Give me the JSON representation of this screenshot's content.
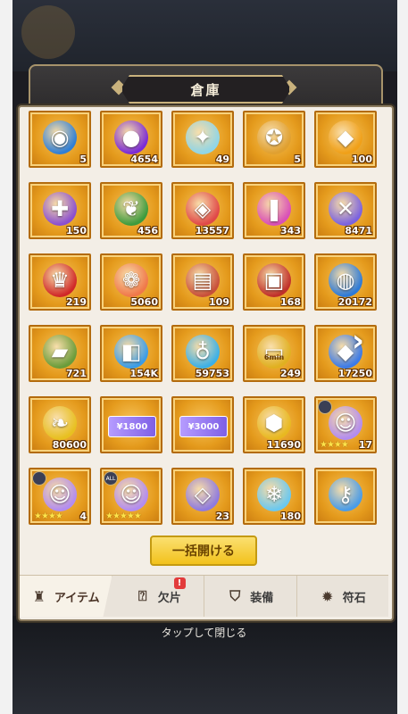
{
  "window": {
    "title": "倉庫"
  },
  "actions": {
    "open_all_label": "一括開ける",
    "close_hint": "タップして閉じる"
  },
  "tabs": [
    {
      "label": "アイテム",
      "icon": "bag-icon",
      "active": true
    },
    {
      "label": "欠片",
      "icon": "question-box-icon",
      "active": false,
      "notification": "!"
    },
    {
      "label": "装備",
      "icon": "shield-icon",
      "active": false
    },
    {
      "label": "符石",
      "icon": "sun-rune-icon",
      "active": false
    }
  ],
  "items": [
    {
      "icon": "portal-orb-icon",
      "qty": "5"
    },
    {
      "icon": "purple-orb-icon",
      "qty": "4654"
    },
    {
      "icon": "star-crystal-icon",
      "qty": "49"
    },
    {
      "icon": "gem-medal-icon",
      "qty": "5"
    },
    {
      "icon": "amber-crystal-icon",
      "qty": "100"
    },
    {
      "icon": "puzzle-piece-icon",
      "qty": "150"
    },
    {
      "icon": "green-crystals-icon",
      "qty": "456"
    },
    {
      "icon": "red-gem-icon",
      "qty": "13557"
    },
    {
      "icon": "pink-scroll-crystal-icon",
      "qty": "343"
    },
    {
      "icon": "crossed-swords-icon",
      "qty": "8471"
    },
    {
      "icon": "red-crystal-crown-icon",
      "qty": "219"
    },
    {
      "icon": "flower-orb-icon",
      "qty": "5060"
    },
    {
      "icon": "map-scroll-icon",
      "qty": "109"
    },
    {
      "icon": "treasure-chest-icon",
      "qty": "168"
    },
    {
      "icon": "blue-orb-gauntlet-icon",
      "qty": "20172"
    },
    {
      "icon": "green-ticket-icon",
      "qty": "721"
    },
    {
      "icon": "blue-cube-icon",
      "qty": "154K"
    },
    {
      "icon": "potion-bottle-icon",
      "qty": "59753"
    },
    {
      "icon": "time-ticket-icon",
      "qty": "249",
      "label": "6min"
    },
    {
      "icon": "blue-crystal-shard-icon",
      "qty": "17250"
    },
    {
      "icon": "gold-leaf-coin-icon",
      "qty": "80600"
    },
    {
      "icon": "voucher-icon",
      "qty": "",
      "label": "¥1800"
    },
    {
      "icon": "voucher-icon",
      "qty": "",
      "label": "¥3000"
    },
    {
      "icon": "gold-hexagon-icon",
      "qty": "11690"
    },
    {
      "icon": "hero-figure-icon",
      "qty": "17",
      "stars": "★★★★",
      "badge": ""
    },
    {
      "icon": "hero-figure-icon",
      "qty": "4",
      "stars": "★★★★",
      "badge": ""
    },
    {
      "icon": "hero-figure-icon",
      "qty": "",
      "stars": "★★★★★",
      "badge": "ALL"
    },
    {
      "icon": "crystal-prism-icon",
      "qty": "23"
    },
    {
      "icon": "ice-crystal-icon",
      "qty": "180"
    },
    {
      "icon": "winged-key-icon",
      "qty": ""
    }
  ]
}
